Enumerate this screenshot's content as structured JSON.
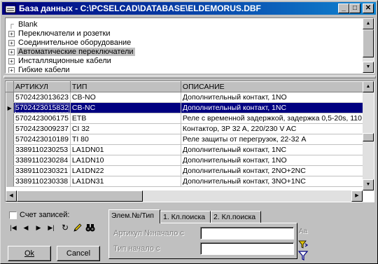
{
  "window": {
    "title": "База данных - C:\\PCSELCAD\\DATABASE\\ELDEMORUS.DBF",
    "minimize": "_",
    "maximize": "□",
    "close": "✕"
  },
  "tree": {
    "items": [
      {
        "label": "Blank",
        "type": "leaf"
      },
      {
        "label": "Переключатели и розетки",
        "type": "branch"
      },
      {
        "label": "Соединительное оборудование",
        "type": "branch"
      },
      {
        "label": "Автоматические переключатели",
        "type": "branch",
        "selected": true
      },
      {
        "label": "Инсталляционные кабели",
        "type": "branch"
      },
      {
        "label": "Гибкие кабели",
        "type": "branch"
      }
    ]
  },
  "grid": {
    "columns": [
      "АРТИКУЛ",
      "ТИП",
      "ОПИСАНИЕ"
    ],
    "selected_row": 1,
    "rows": [
      [
        "5702423013623",
        "CB-NO",
        "Дополнительный контакт, 1NO"
      ],
      [
        "5702423015832",
        "CB-NC",
        "Дополнительный контакт, 1NC"
      ],
      [
        "5702423006175",
        "ETB",
        "Реле с временной задержкой, задержка 0,5-20s, 110"
      ],
      [
        "5702423009237",
        "CI 32",
        "Контактор, 3P 32 A, 220/230 V AC"
      ],
      [
        "5702423010189",
        "TI 80",
        "Реле защиты от перегрузок, 22-32 A"
      ],
      [
        "3389110230253",
        "LA1DN01",
        "Дополнительный контакт,  1NC"
      ],
      [
        "3389110230284",
        "LA1DN10",
        "Дополнительный контакт,  1NO"
      ],
      [
        "3389110230321",
        "LA1DN22",
        "Дополнительный контакт, 2NO+2NC"
      ],
      [
        "3389110230338",
        "LA1DN31",
        "Дополнительный контакт, 3NO+1NC"
      ]
    ]
  },
  "bottom": {
    "record_count_label": "Счет записей:",
    "nav": {
      "first": "|◀",
      "prev": "◀",
      "next": "▶",
      "last": "▶|"
    },
    "ok_label": "Ok",
    "cancel_label": "Cancel",
    "tabs": [
      "Элем.№/Тип",
      "1. Кл.поиска",
      "2. Кл.поиска"
    ],
    "active_tab": 0,
    "article_label": "Артикул №начало с",
    "type_label": "Тип начало с",
    "article_value": "",
    "type_value": "",
    "case_label": "Aa"
  }
}
